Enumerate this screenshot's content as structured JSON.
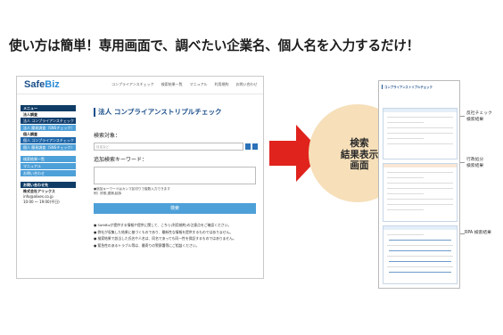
{
  "headline": "使い方は簡単！専用画面で、調べたい企業名、個人名を入力するだけ！",
  "app": {
    "logo": "SafeBiz",
    "logo_main": "Safe",
    "logo_accent": "Biz",
    "nav": [
      "コンプライアンスチェック",
      "検索結果一覧",
      "マニュアル",
      "利用規約",
      "お問い合わせ"
    ]
  },
  "sidebar": {
    "menu_header": "メニュー",
    "corp_header": "法人調査",
    "corp_items": [
      "法人 コンプライアンスチェック",
      "法人 簡易調査（SNSチェック）"
    ],
    "person_header": "個人調査",
    "person_items": [
      "個人 コンプライアンスチェック",
      "個人 簡易調査（SNSチェック）"
    ],
    "other_items": [
      "検索結果一覧",
      "マニュアル",
      "お問い合わせ"
    ],
    "contact_header": "お問い合わせ先",
    "contact_company": "株式会社アリックス",
    "contact_email": "info@alixes.co.jp",
    "contact_hours": "10:00 〜 19:00(平日)"
  },
  "form": {
    "title": "法人 コンプライアンストリプルチェック",
    "target_label": "検索対象：",
    "target_placeholder": "社名など",
    "keyword_label": "追加検索キーワード：",
    "note_line1": "●追加キーワードはカンマ区切りで複数入力できます",
    "note_line2": "例）詐欺,逮捕,起訴",
    "submit_label": "検索",
    "bullets": [
      "● SafeBizが提供する情報や提供に関して、こちら(利用規約)の注意点をご確認ください。",
      "● 弊社が収集した結果に基づくものであり、最新性な情報を提供するものではありません。",
      "● 検索結果で該当した氏名や人名は、同名であっても同一性を保証するものではありません。",
      "● 緊急性のあるトラブル等は、最寄りの警察署等にご相談ください。"
    ]
  },
  "center_bubble": {
    "line1": "検索",
    "line2": "結果表示",
    "line3": "画面"
  },
  "report": {
    "title": "コンプライアンストリプルチェック",
    "sections": [
      "反社チェック結果",
      "行政処分検索結果",
      "RPA検索結果"
    ]
  },
  "labels": {
    "anti_social": [
      "反社チェック",
      "検索結果"
    ],
    "admin_penalty": [
      "行政処分",
      "検索結果"
    ],
    "rpa": "RPA 検索結果"
  },
  "colors": {
    "brand": "#1a4e8a",
    "accent": "#4ea0d8",
    "arrow": "#e0231d",
    "bubble": "#f6dfb9"
  }
}
